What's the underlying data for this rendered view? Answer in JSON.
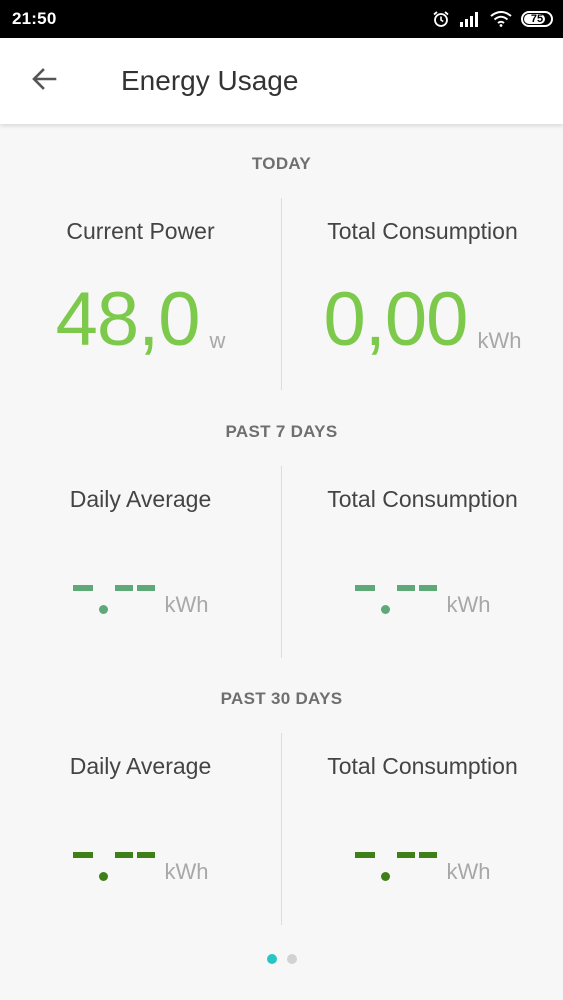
{
  "status_bar": {
    "time": "21:50",
    "battery_level": "75",
    "icons": [
      "alarm-icon",
      "signal-icon",
      "wifi-icon",
      "battery-icon"
    ]
  },
  "app_bar": {
    "title": "Energy Usage",
    "back_icon": "arrow-left-icon"
  },
  "sections": {
    "today": {
      "title": "TODAY",
      "left": {
        "label": "Current Power",
        "value": "48,0",
        "unit": "w"
      },
      "right": {
        "label": "Total Consumption",
        "value": "0,00",
        "unit": "kWh"
      }
    },
    "past7": {
      "title": "PAST 7 DAYS",
      "left": {
        "label": "Daily Average",
        "unit": "kWh"
      },
      "right": {
        "label": "Total Consumption",
        "unit": "kWh"
      }
    },
    "past30": {
      "title": "PAST 30 DAYS",
      "left": {
        "label": "Daily Average",
        "unit": "kWh"
      },
      "right": {
        "label": "Total Consumption",
        "unit": "kWh"
      }
    }
  },
  "pager": {
    "pages": 2,
    "active_index": 0
  },
  "colors": {
    "today_value": "#7dc94b",
    "past7_placeholder": "#5fa878",
    "past30_placeholder": "#3e7f18",
    "pager_active": "#26c6c6",
    "pager_inactive": "#d2d2d2"
  }
}
